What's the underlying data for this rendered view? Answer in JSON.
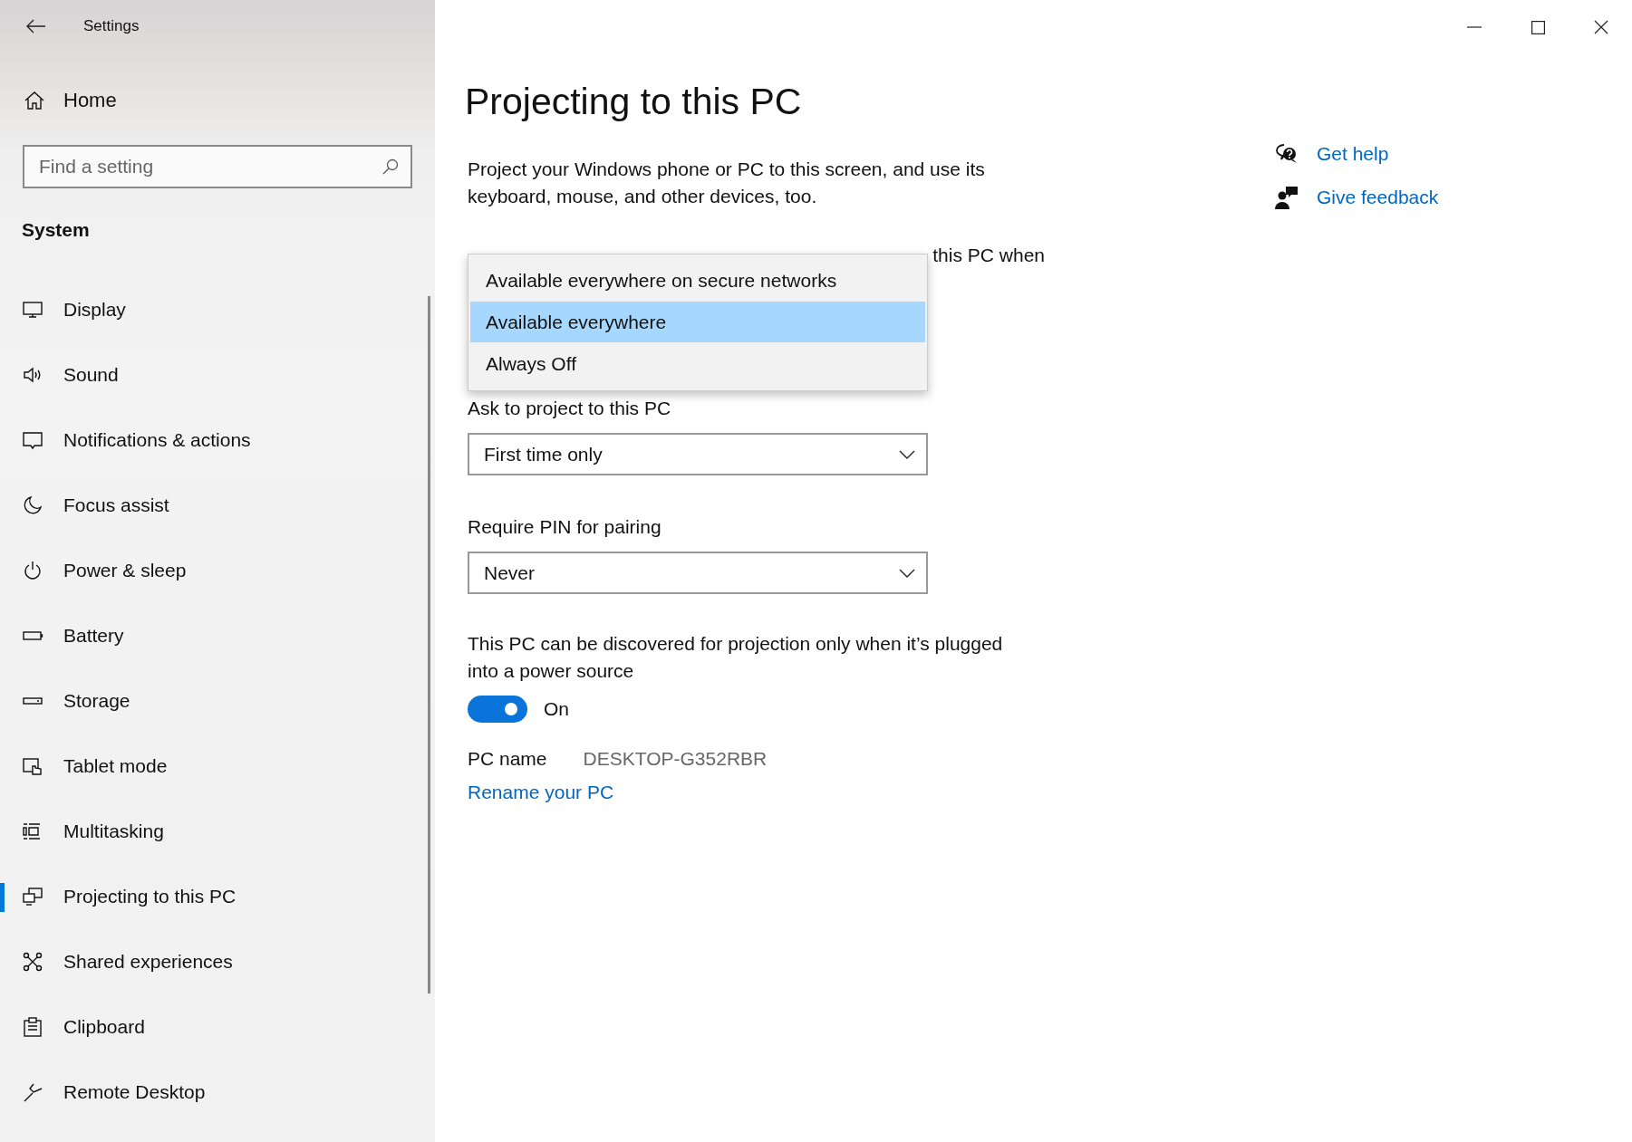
{
  "window": {
    "title": "Settings"
  },
  "sidebar": {
    "home": "Home",
    "search": {
      "placeholder": "Find a setting"
    },
    "section": "System",
    "items": [
      {
        "label": "Display",
        "selected": false
      },
      {
        "label": "Sound",
        "selected": false
      },
      {
        "label": "Notifications & actions",
        "selected": false
      },
      {
        "label": "Focus assist",
        "selected": false
      },
      {
        "label": "Power & sleep",
        "selected": false
      },
      {
        "label": "Battery",
        "selected": false
      },
      {
        "label": "Storage",
        "selected": false
      },
      {
        "label": "Tablet mode",
        "selected": false
      },
      {
        "label": "Multitasking",
        "selected": false
      },
      {
        "label": "Projecting to this PC",
        "selected": true
      },
      {
        "label": "Shared experiences",
        "selected": false
      },
      {
        "label": "Clipboard",
        "selected": false
      },
      {
        "label": "Remote Desktop",
        "selected": false
      }
    ]
  },
  "page": {
    "title": "Projecting to this PC",
    "description": "Project your Windows phone or PC to this screen, and use its keyboard, mouse, and other devices, too.",
    "availability": {
      "label": "this PC when",
      "options": [
        {
          "label": "Available everywhere on secure networks",
          "selected": false
        },
        {
          "label": "Available everywhere",
          "selected": true
        },
        {
          "label": "Always Off",
          "selected": false
        }
      ]
    },
    "ask_to_project": {
      "label": "Ask to project to this PC",
      "value": "First time only"
    },
    "require_pin": {
      "label": "Require PIN for pairing",
      "value": "Never"
    },
    "power_only": {
      "label": "This PC can be discovered for projection only when it’s plugged into a power source",
      "on": true,
      "state": "On"
    },
    "pc_name": {
      "label": "PC name",
      "value": "DESKTOP-G352RBR"
    },
    "rename_link": "Rename your PC"
  },
  "help": {
    "links": [
      "Get help",
      "Give feedback"
    ]
  }
}
